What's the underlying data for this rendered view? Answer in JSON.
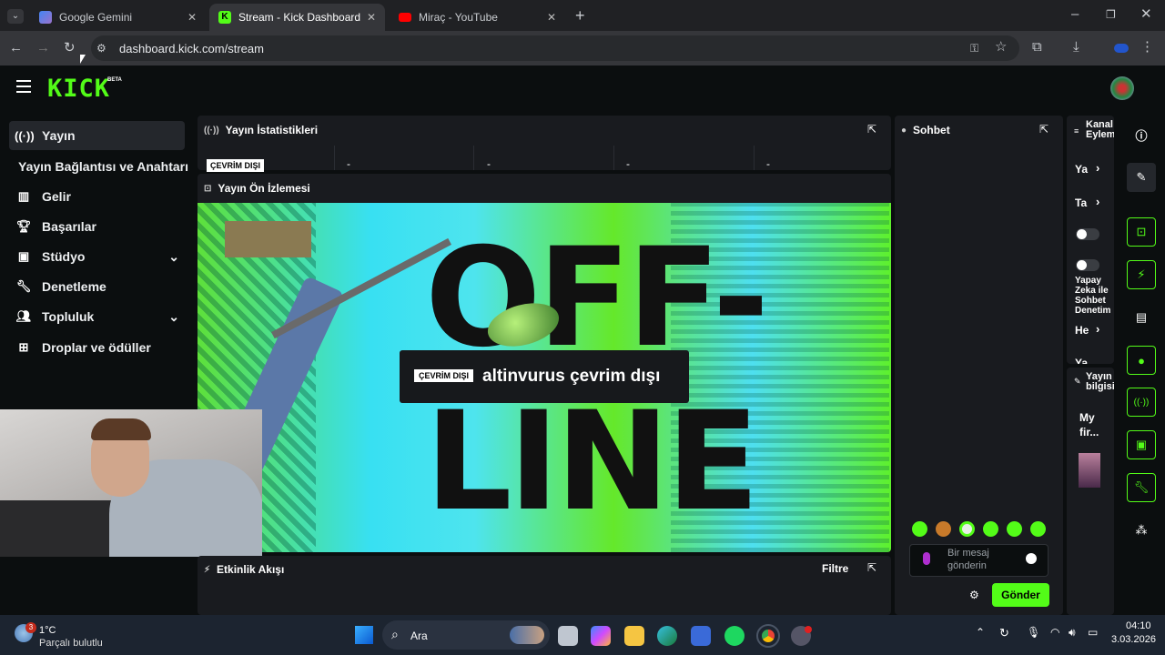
{
  "browser": {
    "tabs": [
      {
        "title": "Google Gemini"
      },
      {
        "title": "Stream - Kick Dashboard"
      },
      {
        "title": "Miraç - YouTube"
      }
    ],
    "url": "dashboard.kick.com/stream"
  },
  "kick": {
    "logo": "KICK",
    "badge": "BETA"
  },
  "sidebar": {
    "items": [
      {
        "label": "Yayın",
        "icon": "broadcast-icon"
      },
      {
        "label": "Yayın Bağlantısı ve Anahtarı"
      },
      {
        "label": "Gelir",
        "icon": "chart-icon"
      },
      {
        "label": "Başarılar",
        "icon": "trophy-icon"
      },
      {
        "label": "Stüdyo",
        "icon": "studio-icon"
      },
      {
        "label": "Denetleme",
        "icon": "wrench-icon"
      },
      {
        "label": "Topluluk",
        "icon": "community-icon"
      },
      {
        "label": "Droplar ve ödüller",
        "icon": "gift-icon"
      }
    ]
  },
  "stats": {
    "title": "Yayın İstatistikleri",
    "status": "ÇEVRİM DIŞI",
    "values": [
      "-",
      "-",
      "-",
      "-"
    ]
  },
  "preview": {
    "title": "Yayın Ön İzlemesi",
    "badge": "ÇEVRİM DIŞI",
    "message": "altinvurus çevrim dışı",
    "art_text_1": "OFF-",
    "art_text_2": "LINE"
  },
  "activity": {
    "title": "Etkinlik Akışı",
    "filter": "Filtre"
  },
  "chat": {
    "title": "Sohbet",
    "placeholder_line1": "Bir mesaj",
    "placeholder_line2": "gönderin",
    "send": "Gönder"
  },
  "channel_actions": {
    "title_line1": "Kanal",
    "title_line2": "Eylem",
    "item1": "Ya",
    "item2": "Ta",
    "item3": "Yapay",
    "item3b": "Zeka ile",
    "item3c": "Sohbet",
    "item3d": "Denetim",
    "item4": "He",
    "item5": "Ya"
  },
  "stream_info": {
    "title_line1": "Yayın",
    "title_line2": "bilgisi",
    "text_line1": "My",
    "text_line2": "fir..."
  },
  "taskbar": {
    "temp": "1°C",
    "weather": "Parçalı bulutlu",
    "search": "Ara",
    "time": "04:10",
    "date": "3.03.2026",
    "notif": "3"
  },
  "colors": {
    "kick_green": "#53fc18",
    "panel": "#191b1f",
    "bg": "#0b0e0f"
  }
}
